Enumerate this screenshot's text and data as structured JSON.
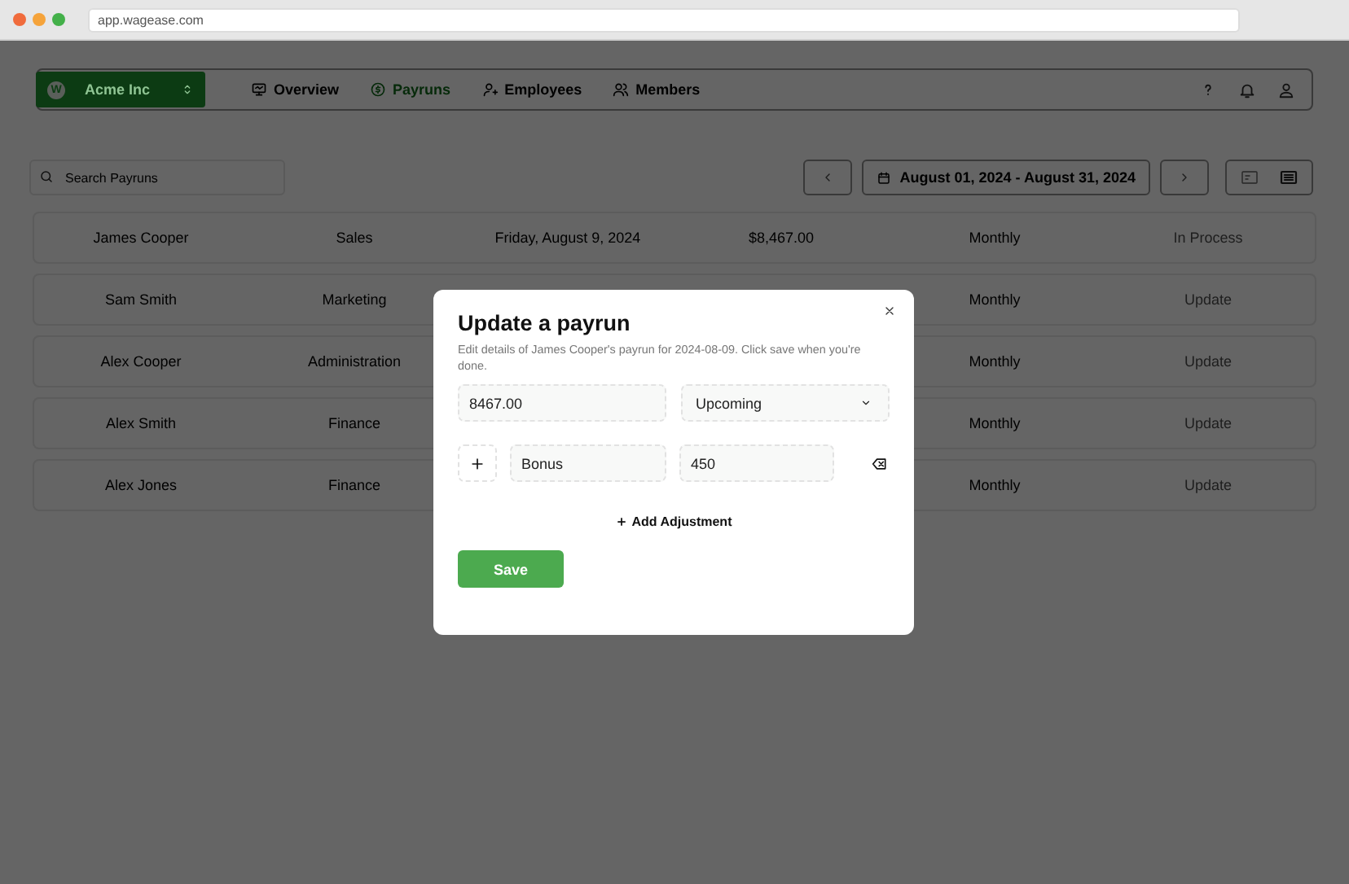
{
  "browser": {
    "url": "app.wagease.com"
  },
  "nav": {
    "workspace": {
      "initial": "W",
      "name": "Acme Inc"
    },
    "links": [
      {
        "label": "Overview",
        "selected": false
      },
      {
        "label": "Payruns",
        "selected": true
      },
      {
        "label": "Employees",
        "selected": false
      },
      {
        "label": "Members",
        "selected": false
      }
    ]
  },
  "toolbar": {
    "search": {
      "placeholder": "Search Payruns"
    },
    "date_range": "August 01, 2024 - August 31, 2024",
    "views": [
      {
        "selected": false
      },
      {
        "selected": true
      }
    ]
  },
  "table": {
    "rows": [
      {
        "name": "James Cooper",
        "department": "Sales",
        "date": "Friday, August 9, 2024",
        "amount": "$8,467.00",
        "frequency": "Monthly",
        "status": "In Process"
      },
      {
        "name": "Sam Smith",
        "department": "Marketing",
        "frequency": "Monthly",
        "status": "Update"
      },
      {
        "name": "Alex Cooper",
        "department": "Administration",
        "frequency": "Monthly",
        "status": "Update"
      },
      {
        "name": "Alex Smith",
        "department": "Finance",
        "frequency": "Monthly",
        "status": "Update"
      },
      {
        "name": "Alex Jones",
        "department": "Finance",
        "frequency": "Monthly",
        "status": "Update"
      }
    ]
  },
  "modal": {
    "title": "Update a payrun",
    "description": "Edit details of James Cooper's payrun for 2024-08-09. Click save when you're done.",
    "amount": "8467.00",
    "status": "Upcoming",
    "adjustments": [
      {
        "label": "Bonus",
        "amount": "450"
      }
    ],
    "add_button": "Add Adjustment",
    "save_button": "Save"
  }
}
